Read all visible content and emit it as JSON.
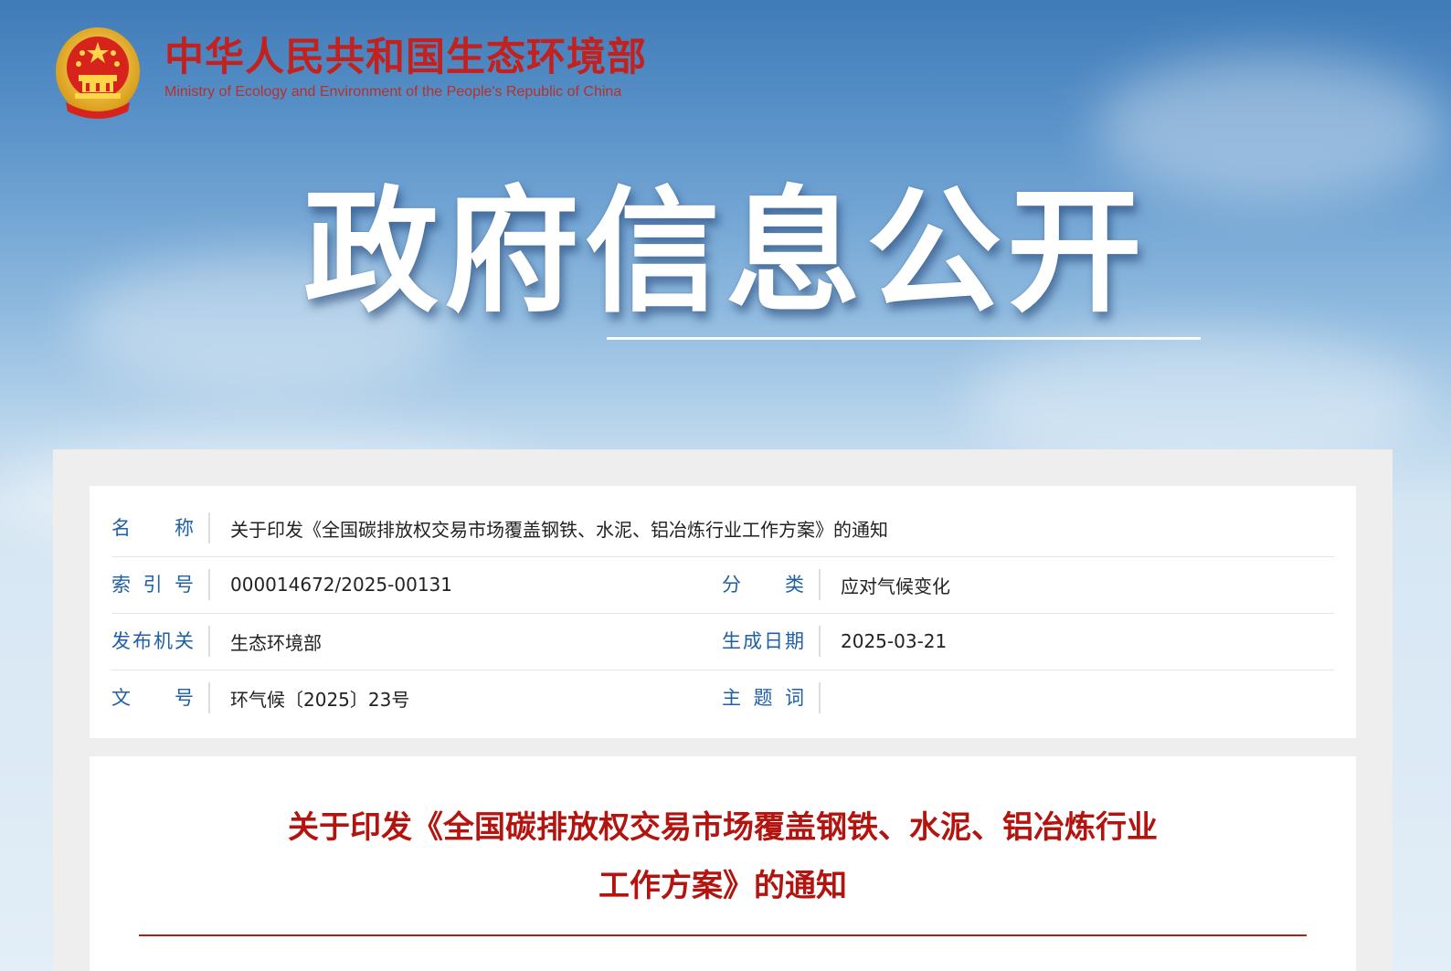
{
  "header": {
    "site_title": "中华人民共和国生态环境部",
    "site_subtitle": "Ministry of Ecology and Environment of the People's Republic of China",
    "emblem_icon": "national-emblem-icon"
  },
  "banner": {
    "title": "政府信息公开"
  },
  "metadata": {
    "name_label": "名称",
    "name_value": "关于印发《全国碳排放权交易市场覆盖钢铁、水泥、铝冶炼行业工作方案》的通知",
    "index_label": "索引号",
    "index_value": "000014672/2025-00131",
    "category_label": "分类",
    "category_value": "应对气候变化",
    "issuer_label": "发布机关",
    "issuer_value": "生态环境部",
    "date_label": "生成日期",
    "date_value": "2025-03-21",
    "docno_label": "文号",
    "docno_value": "环气候〔2025〕23号",
    "keywords_label": "主题词",
    "keywords_value": ""
  },
  "article": {
    "title_line1": "关于印发《全国碳排放权交易市场覆盖钢铁、水泥、铝冶炼行业",
    "title_line2": "工作方案》的通知"
  },
  "colors": {
    "brand_red": "#c2211e",
    "label_blue": "#1f5fa6",
    "article_title_red": "#b4140f"
  }
}
